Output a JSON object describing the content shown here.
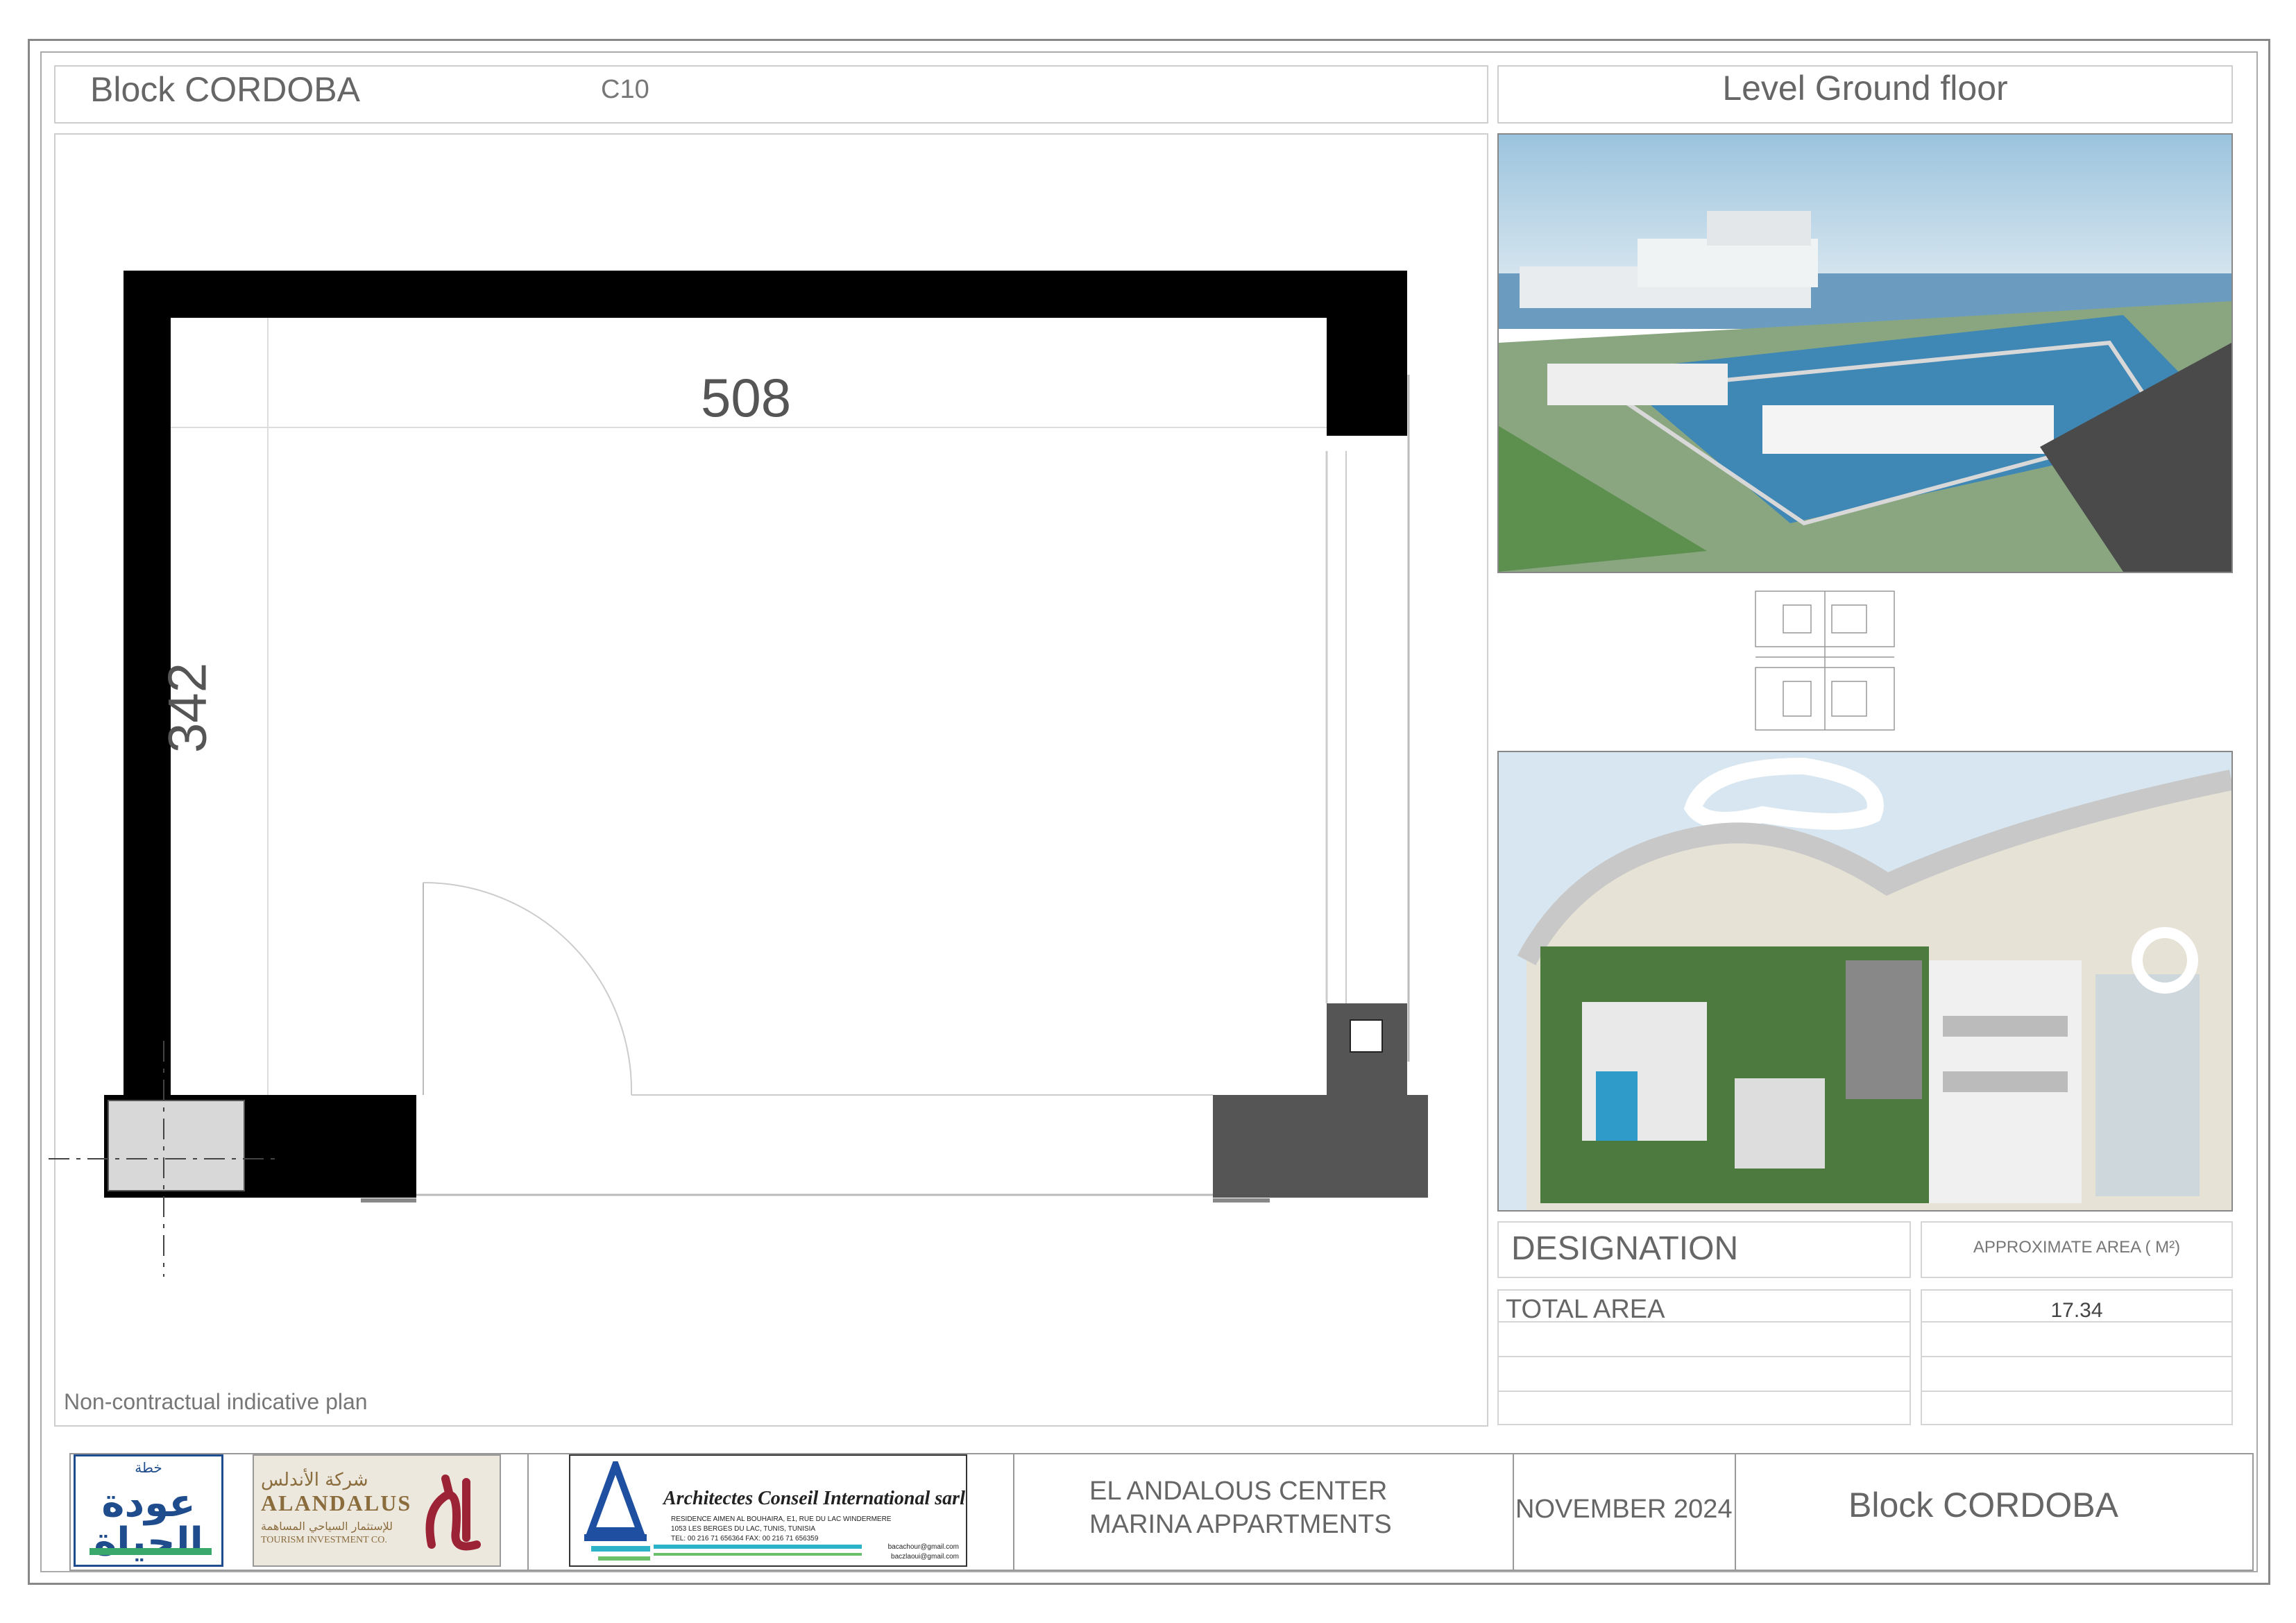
{
  "header": {
    "block_title": "Block CORDOBA",
    "unit_code": "C10",
    "level": "Level Ground floor"
  },
  "plan": {
    "width_label": "508",
    "height_label": "342",
    "note": "Non-contractual indicative plan"
  },
  "table": {
    "col1_header": "DESIGNATION",
    "col2_header": "APPROXIMATE AREA  ( M²)",
    "rows": [
      {
        "label": "TOTAL AREA",
        "value": "17.34"
      }
    ]
  },
  "footer": {
    "logo1_arabic": "عودة الحياة",
    "logo1_small": "خطة",
    "logo2_arabic": "شركة الأندلس",
    "logo2_sub_arabic": "للإستثمار السياحي المساهمة",
    "logo2_name": "ALANDALUS",
    "logo2_sub": "TOURISM INVESTMENT CO.",
    "logo3_name": "Architectes Conseil International sarl",
    "logo3_addr1": "RESIDENCE AIMEN AL BOUHAIRA, E1, RUE DU LAC WINDERMERE",
    "logo3_addr2": "1053 LES BERGES DU LAC, TUNIS, TUNISIA",
    "logo3_tel": "TEL: 00 216 71 656364   FAX: 00 216 71 656359",
    "logo3_email1": "bacachour@gmail.com",
    "logo3_email2": "baczlaoui@gmail.com",
    "project_line1": "EL ANDALOUS CENTER",
    "project_line2": "MARINA APPARTMENTS",
    "date": "NOVEMBER 2024",
    "block": "Block  CORDOBA"
  }
}
